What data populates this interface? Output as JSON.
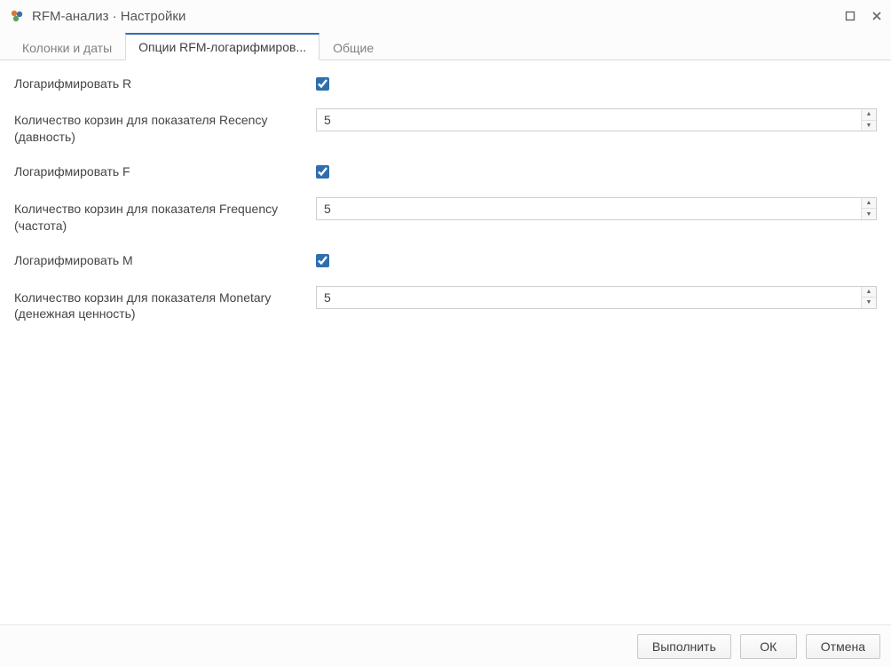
{
  "window": {
    "title": "RFM-анализ · Настройки"
  },
  "tabs": {
    "items": [
      {
        "label": "Колонки и даты",
        "active": false
      },
      {
        "label": "Опции RFM-логарифмиров...",
        "active": true
      },
      {
        "label": "Общие",
        "active": false
      }
    ]
  },
  "form": {
    "log_r": {
      "label": "Логарифмировать R",
      "checked": true
    },
    "bins_r": {
      "label": "Количество корзин для показателя Recency (давность)",
      "value": "5"
    },
    "log_f": {
      "label": "Логарифмировать F",
      "checked": true
    },
    "bins_f": {
      "label": "Количество корзин для показателя Frequency (частота)",
      "value": "5"
    },
    "log_m": {
      "label": "Логарифмировать M",
      "checked": true
    },
    "bins_m": {
      "label": "Количество корзин для показателя Monetary (денежная ценность)",
      "value": "5"
    }
  },
  "footer": {
    "run": "Выполнить",
    "ok": "ОК",
    "cancel": "Отмена"
  }
}
